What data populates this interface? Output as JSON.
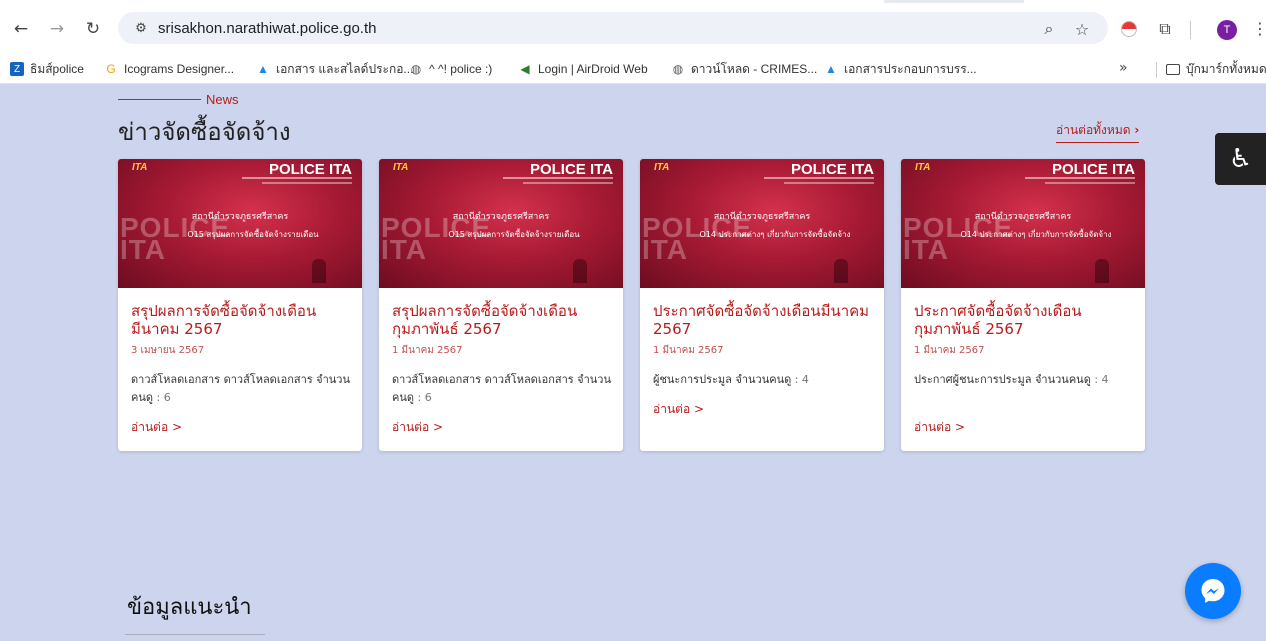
{
  "browser": {
    "url": "srisakhon.narathiwat.police.go.th",
    "avatar_initial": "T",
    "bookmarks": [
      {
        "label": "ธิมส์police",
        "icon": "zdrive-icon",
        "color": "#1565c0"
      },
      {
        "label": "Icograms Designer...",
        "icon": "icograms-icon",
        "color": "#f4a100"
      },
      {
        "label": "เอกสาร และสไลด์ประกอ...",
        "icon": "google-drive-icon",
        "color": "#1e88e5"
      },
      {
        "label": "^ ^! police :)",
        "icon": "globe-icon",
        "color": "#555555"
      },
      {
        "label": "Login | AirDroid Web",
        "icon": "airdroid-icon",
        "color": "#2e7d32"
      },
      {
        "label": "ดาวน์โหลด - CRIMES...",
        "icon": "globe-icon",
        "color": "#555555"
      },
      {
        "label": "เอกสารประกอบการบรร...",
        "icon": "google-drive-icon",
        "color": "#1e88e5"
      }
    ],
    "bookmarks_more": "»",
    "all_bookmarks": "บุ๊กมาร์กทั้งหมด"
  },
  "page": {
    "news_label": "News",
    "section_title": "ข่าวจัดซื้อจัดจ้าง",
    "read_all": "อ่านต่อทั้งหมด",
    "section2_title": "ข้อมูลแนะนำ",
    "cards": [
      {
        "thumb_brand": "POLICE ITA",
        "thumb_logo": "ITA",
        "thumb_bigtext": [
          "POLICE",
          "ITA"
        ],
        "thumb_station": "สถานีตำรวจภูธรศรีสาคร",
        "thumb_sub": "O15 สรุปผลการจัดซื้อจัดจ้างรายเดือน",
        "title": "สรุปผลการจัดซื้อจัดจ้างเดือนมีนาคม 2567",
        "date": "3 เมษายน 2567",
        "desc": "ดาวส์โหลดเอกสาร ดาวส์โหลดเอกสาร จำนวนคนดู",
        "count": ": 6",
        "more": "อ่านต่อ >"
      },
      {
        "thumb_brand": "POLICE ITA",
        "thumb_logo": "ITA",
        "thumb_bigtext": [
          "POLICE",
          "ITA"
        ],
        "thumb_station": "สถานีตำรวจภูธรศรีสาคร",
        "thumb_sub": "O15 สรุปผลการจัดซื้อจัดจ้างรายเดือน",
        "title": "สรุปผลการจัดซื้อจัดจ้างเดือนกุมภาพันธ์ 2567",
        "date": "1 มีนาคม 2567",
        "desc": "ดาวส์โหลดเอกสาร ดาวส์โหลดเอกสาร จำนวนคนดู",
        "count": ": 6",
        "more": "อ่านต่อ >"
      },
      {
        "thumb_brand": "POLICE ITA",
        "thumb_logo": "ITA",
        "thumb_bigtext": [
          "POLICE",
          "ITA"
        ],
        "thumb_station": "สถานีตำรวจภูธรศรีสาคร",
        "thumb_sub": "O14 ประกาศต่างๆ เกี่ยวกับการจัดซื้อจัดจ้าง",
        "title": "ประกาศจัดซื้อจัดจ้างเดือนมีนาคม 2567",
        "date": "1 มีนาคม 2567",
        "desc": "ผู้ชนะการประมูล จำนวนคนดู",
        "count": ": 4",
        "more": "อ่านต่อ >"
      },
      {
        "thumb_brand": "POLICE ITA",
        "thumb_logo": "ITA",
        "thumb_bigtext": [
          "POLICE",
          "ITA"
        ],
        "thumb_station": "สถานีตำรวจภูธรศรีสาคร",
        "thumb_sub": "O14 ประกาศต่างๆ เกี่ยวกับการจัดซื้อจัดจ้าง",
        "title": "ประกาศจัดซื้อจัดจ้างเดือนกุมภาพันธ์ 2567",
        "date": "1 มีนาคม 2567",
        "desc": "ประกาศผู้ชนะการประมูล จำนวนคนดู",
        "count": ": 4",
        "more": "อ่านต่อ >"
      }
    ]
  },
  "colors": {
    "accent": "#b71c1c",
    "page_bg": "#ccd4ee",
    "messenger": "#0a7cff"
  }
}
